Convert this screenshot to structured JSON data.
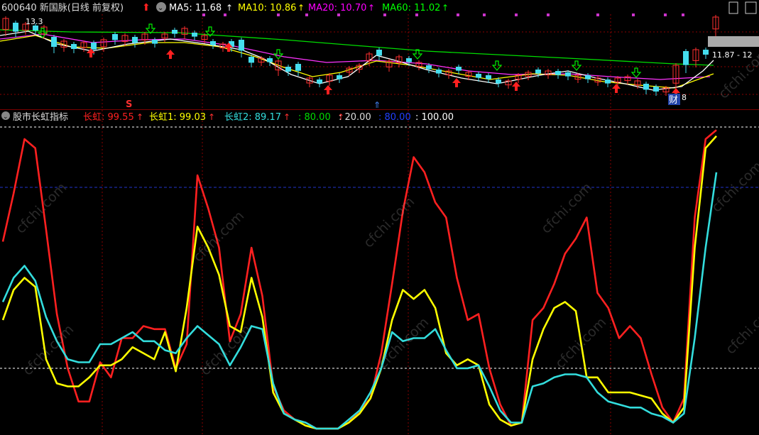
{
  "header": {
    "stock": "600640 新国脉(日线 前复权)",
    "ma": [
      {
        "label": "MA5: 11.68",
        "color": "#ffffff"
      },
      {
        "label": "MA10: 10.86",
        "color": "#ffff00"
      },
      {
        "label": "MA20: 10.70",
        "color": "#ff00ff"
      },
      {
        "label": "MA60: 11.02",
        "color": "#00ff00"
      }
    ]
  },
  "price_panel": {
    "high_label": "13.3",
    "right_label": "11.87 - 12",
    "low_label": "8",
    "cai_label": "财",
    "s_label": "S"
  },
  "indicator": {
    "name": "股市长虹指标",
    "items": [
      {
        "label": "长虹: 99.55",
        "color": "#ff2020"
      },
      {
        "label": "长虹1: 99.03",
        "color": "#ffff00"
      },
      {
        "label": "长虹2: 89.17",
        "color": "#33dddd"
      },
      {
        "label": ": 80.00",
        "color": "#00dd00"
      },
      {
        "label": ": 20.00",
        "color": "#dddddd"
      },
      {
        "label": ": 80.00",
        "color": "#2040ff"
      },
      {
        "label": ": 100.00",
        "color": "#ffffff"
      }
    ]
  },
  "watermark": "cfchi.com",
  "chart_data": [
    {
      "type": "line",
      "name": "股市长虹指标",
      "ylim": [
        0,
        100
      ],
      "reference_lines": [
        100,
        80,
        20
      ],
      "x": [
        0,
        1,
        2,
        3,
        4,
        5,
        6,
        7,
        8,
        9,
        10,
        11,
        12,
        13,
        14,
        15,
        16,
        17,
        18,
        19,
        20,
        21,
        22,
        23,
        24,
        25,
        26,
        27,
        28,
        29,
        30,
        31,
        32,
        33,
        34,
        35,
        36,
        37,
        38,
        39,
        40,
        41,
        42,
        43,
        44,
        45,
        46,
        47,
        48,
        49,
        50,
        51,
        52,
        53,
        54,
        55,
        56,
        57,
        58,
        59,
        60,
        61,
        62,
        63,
        64,
        65,
        66
      ],
      "series": [
        {
          "name": "长虹",
          "color": "#ff2020",
          "values": [
            62,
            78,
            96,
            93,
            66,
            38,
            20,
            9,
            9,
            22,
            17,
            30,
            30,
            34,
            33,
            33,
            20,
            28,
            84,
            73,
            60,
            29,
            38,
            60,
            44,
            14,
            6,
            3,
            2,
            0,
            0,
            0,
            2,
            6,
            10,
            25,
            48,
            72,
            90,
            85,
            75,
            70,
            50,
            36,
            38,
            20,
            8,
            1,
            2,
            36,
            40,
            48,
            58,
            63,
            70,
            45,
            40,
            30,
            34,
            30,
            18,
            7,
            2,
            10,
            70,
            96,
            99
          ]
        },
        {
          "name": "长虹1",
          "color": "#ffff00",
          "values": [
            36,
            46,
            50,
            47,
            23,
            15,
            14,
            14,
            17,
            21,
            21,
            23,
            27,
            25,
            23,
            32,
            19,
            40,
            67,
            60,
            51,
            34,
            32,
            50,
            37,
            12,
            5,
            3,
            1,
            0,
            0,
            0,
            2,
            5,
            10,
            20,
            36,
            46,
            43,
            46,
            40,
            25,
            21,
            23,
            21,
            8,
            3,
            1,
            2,
            23,
            33,
            40,
            42,
            39,
            17,
            17,
            12,
            12,
            12,
            11,
            10,
            5,
            2,
            7,
            60,
            93,
            97
          ]
        },
        {
          "name": "长虹2",
          "color": "#33dddd",
          "values": [
            42,
            50,
            54,
            49,
            37,
            29,
            23,
            22,
            22,
            28,
            28,
            30,
            32,
            29,
            29,
            26,
            25,
            30,
            34,
            31,
            28,
            21,
            27,
            34,
            33,
            15,
            5,
            3,
            2,
            0,
            0,
            0,
            3,
            6,
            12,
            20,
            32,
            29,
            30,
            30,
            33,
            26,
            20,
            20,
            21,
            14,
            6,
            2,
            2,
            14,
            15,
            17,
            18,
            18,
            17,
            12,
            9,
            8,
            7,
            7,
            5,
            4,
            2,
            5,
            30,
            60,
            85
          ]
        }
      ]
    },
    {
      "type": "candlestick",
      "name": "600640 新国脉 日线",
      "ma_series": [
        "MA5",
        "MA10",
        "MA20",
        "MA60"
      ]
    }
  ]
}
